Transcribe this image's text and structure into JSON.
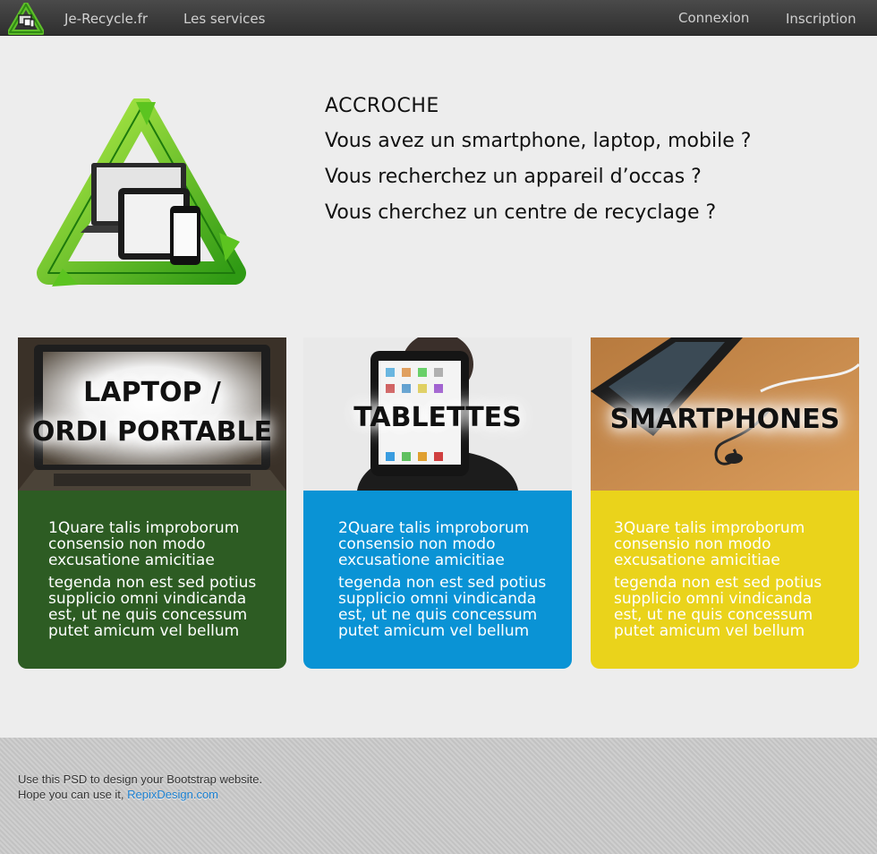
{
  "nav": {
    "brand": "Je-Recycle.fr",
    "services": "Les services",
    "login": "Connexion",
    "signup": "Inscription"
  },
  "hero": {
    "heading": "ACCROCHE",
    "lines": [
      "Vous avez un smartphone, laptop, mobile ?",
      "Vous recherchez un appareil d’occas ?",
      "Vous cherchez un centre de recyclage ?"
    ]
  },
  "cards": [
    {
      "title_lines": [
        "LAPTOP /",
        "ORDI PORTABLE"
      ],
      "p1": "1Quare talis improborum consensio non modo excusatione amicitiae",
      "p2": "tegenda non est sed potius supplicio omni vindicanda est, ut ne quis concessum putet amicum vel bellum",
      "color": "#2d5c23"
    },
    {
      "title_lines": [
        "TABLETTES"
      ],
      "p1": "2Quare talis improborum consensio non modo excusatione amicitiae",
      "p2": "tegenda non est sed potius supplicio omni vindicanda est, ut ne quis concessum putet amicum vel bellum",
      "color": "#0a93d5"
    },
    {
      "title_lines": [
        "SMARTPHONES"
      ],
      "p1": "3Quare talis improborum consensio non modo excusatione amicitiae",
      "p2": "tegenda non est sed potius supplicio omni vindicanda est, ut ne quis concessum putet amicum vel bellum",
      "color": "#ead31b"
    }
  ],
  "footer": {
    "line1": "Use this PSD to design your Bootstrap website.",
    "line2_prefix": "Hope you can use it, ",
    "link": "RepixDesign.com"
  },
  "icons": {
    "logo": "recycle-devices-logo-icon",
    "hero": "recycle-devices-icon"
  }
}
